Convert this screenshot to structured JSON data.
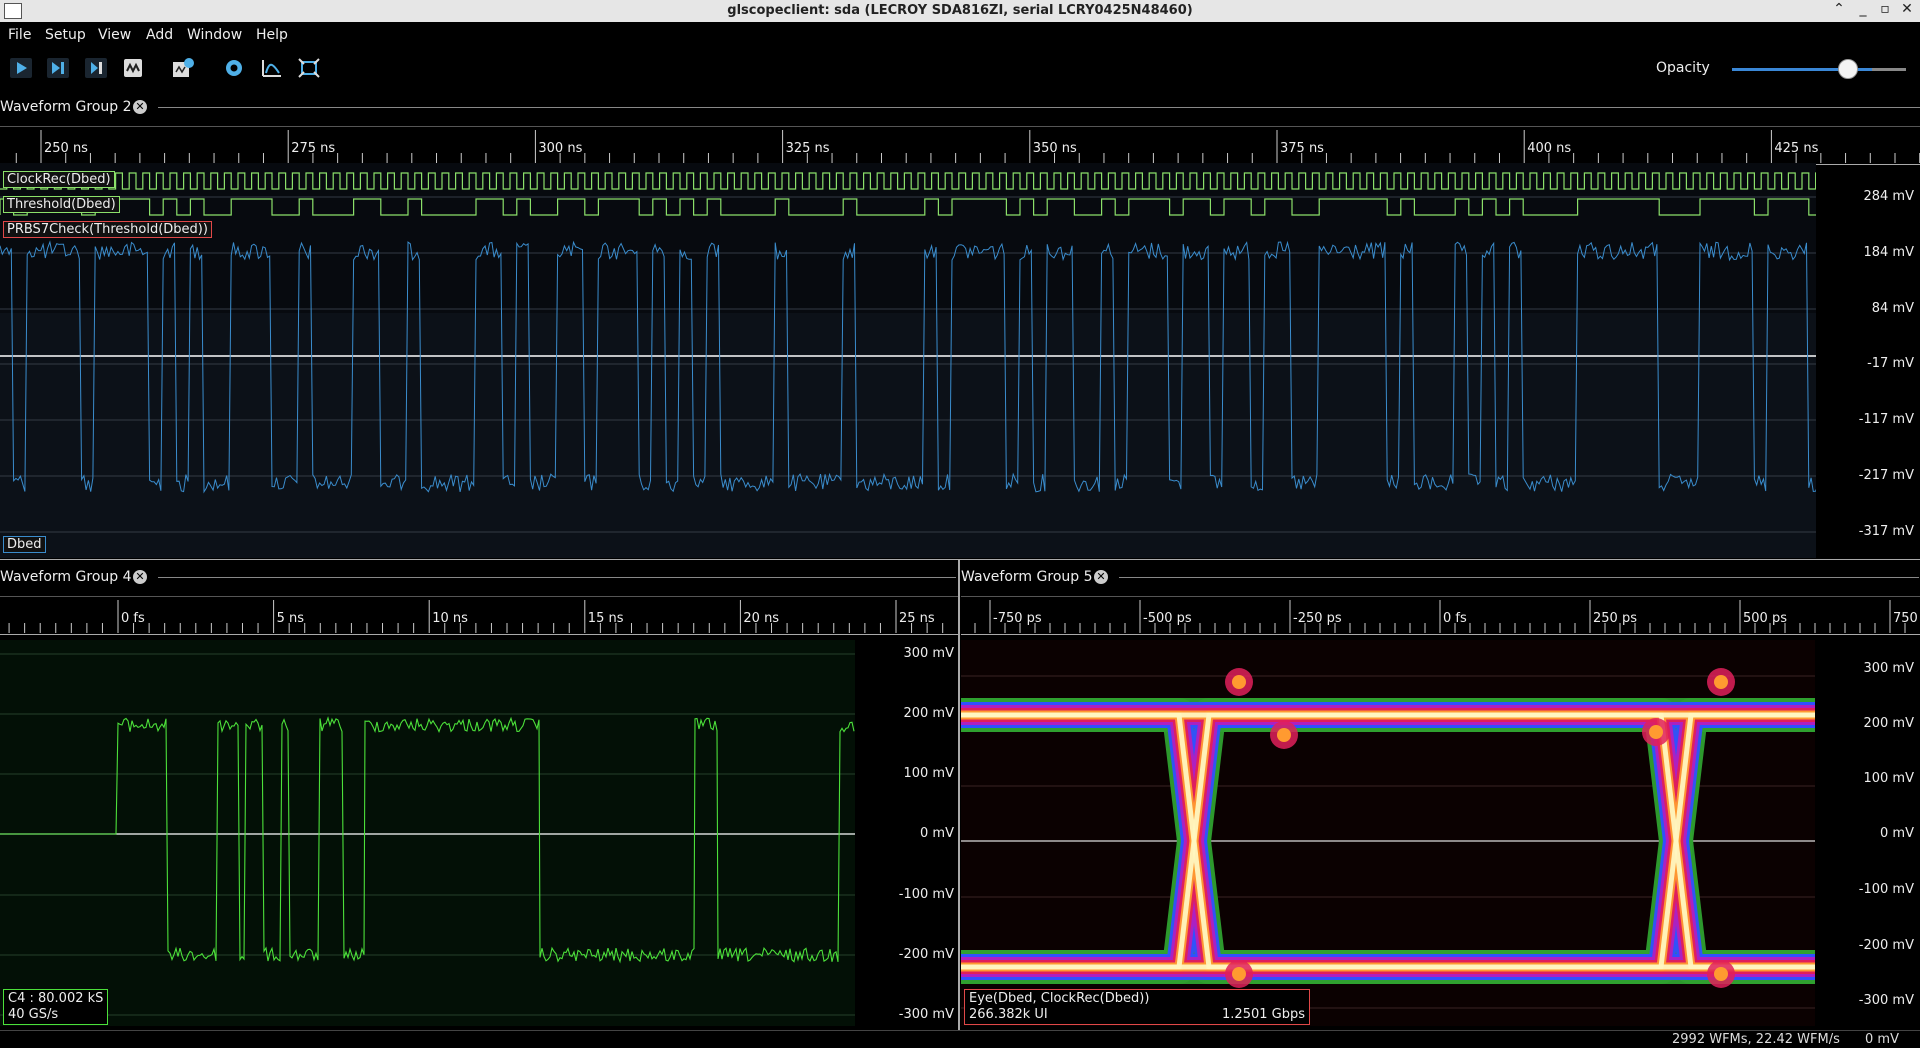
{
  "window": {
    "title": "glscopeclient: sda (LECROY SDA816ZI, serial LCRY0425N48460)",
    "controls": [
      "⌃",
      "_",
      "▫",
      "✕"
    ]
  },
  "menu": [
    "File",
    "Setup",
    "View",
    "Add",
    "Window",
    "Help"
  ],
  "toolbar": {
    "buttons": [
      "start-trigger-icon",
      "single-trigger-icon",
      "force-trigger-icon",
      "stop-trigger-icon",
      "add-waveform-icon",
      "settings-icon",
      "zoom-fit-icon",
      "fullscreen-icon"
    ],
    "opacity_label": "Opacity",
    "opacity_value": 0.76
  },
  "group2": {
    "title": "Waveform Group 2",
    "time_ticks": [
      "250 ns",
      "275 ns",
      "300 ns",
      "325 ns",
      "350 ns",
      "375 ns",
      "400 ns",
      "425 ns"
    ],
    "v_ticks": [
      "284 mV",
      "184 mV",
      "84 mV",
      "-17 mV",
      "-117 mV",
      "-217 mV",
      "-317 mV"
    ],
    "channels": [
      "ClockRec(Dbed)",
      "Threshold(Dbed)",
      "PRBS7Check(Threshold(Dbed))"
    ],
    "analog_label": "Dbed",
    "colors": {
      "clock": "#8be06a",
      "threshold": "#8be06a",
      "analog": "#3a8ccc",
      "prbs_border": "#e04848"
    }
  },
  "group4": {
    "title": "Waveform Group 4",
    "time_ticks": [
      "0 fs",
      "5 ns",
      "10 ns",
      "15 ns",
      "20 ns",
      "25 ns"
    ],
    "v_ticks": [
      "300 mV",
      "200 mV",
      "100 mV",
      "0 mV",
      "-100 mV",
      "-200 mV",
      "-300 mV"
    ],
    "info_line1": "C4 : 80.002 kS",
    "info_line2": "40 GS/s",
    "color": "#4ce03a"
  },
  "group5": {
    "title": "Waveform Group 5",
    "time_ticks": [
      "-750 ps",
      "-500 ps",
      "-250 ps",
      "0 fs",
      "250 ps",
      "500 ps",
      "750"
    ],
    "v_ticks": [
      "300 mV",
      "200 mV",
      "100 mV",
      "0 mV",
      "-100 mV",
      "-200 mV",
      "-300 mV"
    ],
    "info_line1": "Eye(Dbed, ClockRec(Dbed))",
    "info_line2_left": "266.382k UI",
    "info_line2_right": "1.2501 Gbps"
  },
  "status": {
    "rate": "2992 WFMs, 22.42 WFM/s",
    "cursor": "0 mV"
  }
}
